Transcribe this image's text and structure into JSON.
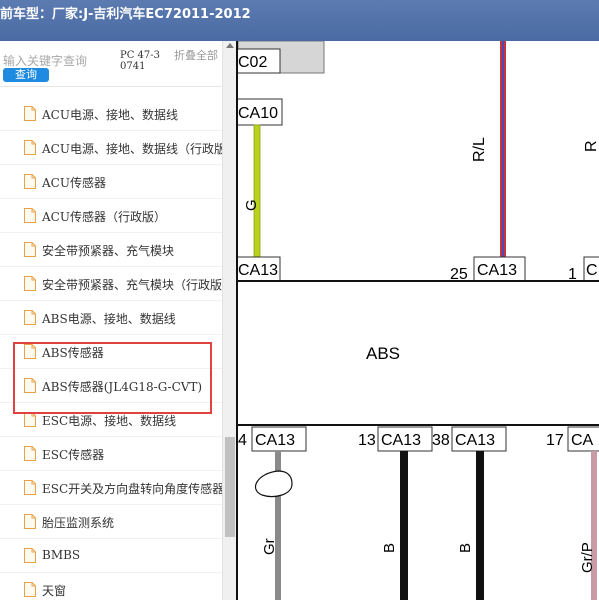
{
  "window": {
    "title": "前车型：厂家:J-吉利汽车EC72011-2012"
  },
  "sidebar": {
    "search": {
      "placeholder": "输入关键字查询",
      "button_label": "查询"
    },
    "part_code": "PC 47-30741",
    "collapse_all_label": "折叠全部",
    "items": [
      {
        "label": "ACU电源、接地、数据线"
      },
      {
        "label": "ACU电源、接地、数据线（行政版）"
      },
      {
        "label": "ACU传感器"
      },
      {
        "label": "ACU传感器（行政版）"
      },
      {
        "label": "安全带预紧器、充气模块"
      },
      {
        "label": "安全带预紧器、充气模块（行政版）"
      },
      {
        "label": "ABS电源、接地、数据线"
      },
      {
        "label": "ABS传感器"
      },
      {
        "label": "ABS传感器(JL4G18-G-CVT)"
      },
      {
        "label": "ESC电源、接地、数据线"
      },
      {
        "label": "ESC传感器"
      },
      {
        "label": "ESC开关及方向盘转向角度传感器"
      },
      {
        "label": "胎压监测系统"
      },
      {
        "label": "BMBS"
      },
      {
        "label": "天窗"
      }
    ],
    "icon": "file-icon",
    "highlight_color": "#e0433f"
  },
  "diagram": {
    "connectors": {
      "top_left": "C02",
      "ca10": "CA10",
      "ca13_left": "CA13",
      "ca13_mid": "CA13",
      "ca13_right": "C",
      "pin_25": "25",
      "pin_1": "1",
      "bottom_1": "CA13",
      "bottom_2": "CA13",
      "bottom_3": "CA13",
      "bottom_4": "CA",
      "pin_4": "4",
      "pin_13": "13",
      "pin_38": "38",
      "pin_17": "17"
    },
    "module_label": "ABS",
    "wire_labels": {
      "rl": "R/L",
      "r": "R",
      "gr": "Gr",
      "b1": "B",
      "b2": "B",
      "grp": "Gr/P",
      "gr_partial": "G"
    },
    "colors": {
      "yellow_green_wire": "#b9d21e",
      "red_blue_wire": "#c6333b",
      "blue_stripe": "#4a4ab8",
      "gray_wire": "#8a8a8a",
      "black_wire": "#111111",
      "pink_wire": "#c79aa6",
      "connector_fill": "#d6d6d6"
    }
  }
}
